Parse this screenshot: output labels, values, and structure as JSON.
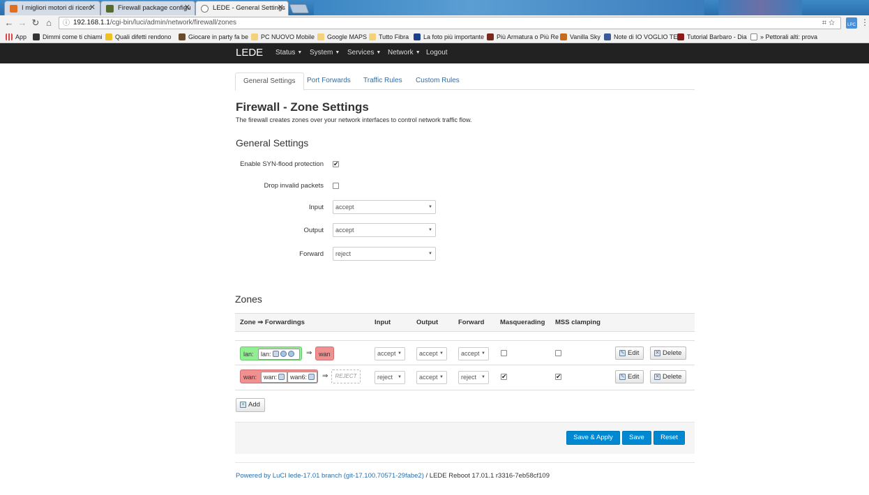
{
  "browser": {
    "tabs": [
      {
        "title": "I migliori motori di ricerc"
      },
      {
        "title": "Firewall package configu"
      },
      {
        "title": "LEDE - General Settings"
      }
    ],
    "address": {
      "host": "192.168.1.1",
      "path": "/cgi-bin/luci/admin/network/firewall/zones"
    },
    "bookmarks": [
      "App",
      "Dimmi come ti chiami",
      "Quali difetti rendono",
      "Giocare in party fa be",
      "PC NUOVO Mobile",
      "Google MAPS",
      "Tutto Fibra",
      "La foto più importante",
      "Più Armatura o Più Re",
      "Vanilla Sky",
      "Note di IO VOGLIO TE",
      "Tutorial Barbaro - Dia",
      "» Pettorali alti: prova"
    ]
  },
  "navbar": {
    "brand": "LEDE",
    "items": [
      "Status",
      "System",
      "Services",
      "Network",
      "Logout"
    ]
  },
  "tabs": [
    "General Settings",
    "Port Forwards",
    "Traffic Rules",
    "Custom Rules"
  ],
  "page": {
    "title": "Firewall - Zone Settings",
    "description": "The firewall creates zones over your network interfaces to control network traffic flow."
  },
  "general": {
    "heading": "General Settings",
    "syn_label": "Enable SYN-flood protection",
    "syn_checked": true,
    "drop_label": "Drop invalid packets",
    "drop_checked": false,
    "input_label": "Input",
    "input_value": "accept",
    "output_label": "Output",
    "output_value": "accept",
    "forward_label": "Forward",
    "forward_value": "reject"
  },
  "zones": {
    "heading": "Zones",
    "headers": [
      "Zone ⇒ Forwardings",
      "Input",
      "Output",
      "Forward",
      "Masquerading",
      "MSS clamping"
    ],
    "rows": [
      {
        "zone": "lan:",
        "ifaces": [
          "lan:"
        ],
        "arrow": "⇒",
        "dest": "wan",
        "input": "accept",
        "output": "accept",
        "forward": "accept",
        "masq": false,
        "mss": false,
        "edit": "Edit",
        "delete": "Delete"
      },
      {
        "zone": "wan:",
        "ifaces": [
          "wan:",
          "wan6:"
        ],
        "arrow": "⇒",
        "dest": "REJECT",
        "input": "reject",
        "output": "accept",
        "forward": "reject",
        "masq": true,
        "mss": true,
        "edit": "Edit",
        "delete": "Delete"
      }
    ],
    "add_label": "Add"
  },
  "actions": {
    "save_apply": "Save & Apply",
    "save": "Save",
    "reset": "Reset"
  },
  "footer": {
    "link": "Powered by LuCI lede-17.01 branch (git-17.100.70571-29fabe2)",
    "text": " / LEDE Reboot 17.01.1 r3316-7eb58cf109"
  },
  "colors": {
    "navbar": "#222222",
    "primary_button": "#0288d1",
    "lan_zone": "#90f090",
    "wan_zone": "#f09090",
    "link": "#2a6fae"
  },
  "icons": [
    "back-arrow-icon",
    "forward-arrow-icon",
    "reload-icon",
    "home-icon",
    "star-icon",
    "translate-icon",
    "network-icon",
    "edit-icon",
    "delete-icon",
    "add-icon"
  ]
}
